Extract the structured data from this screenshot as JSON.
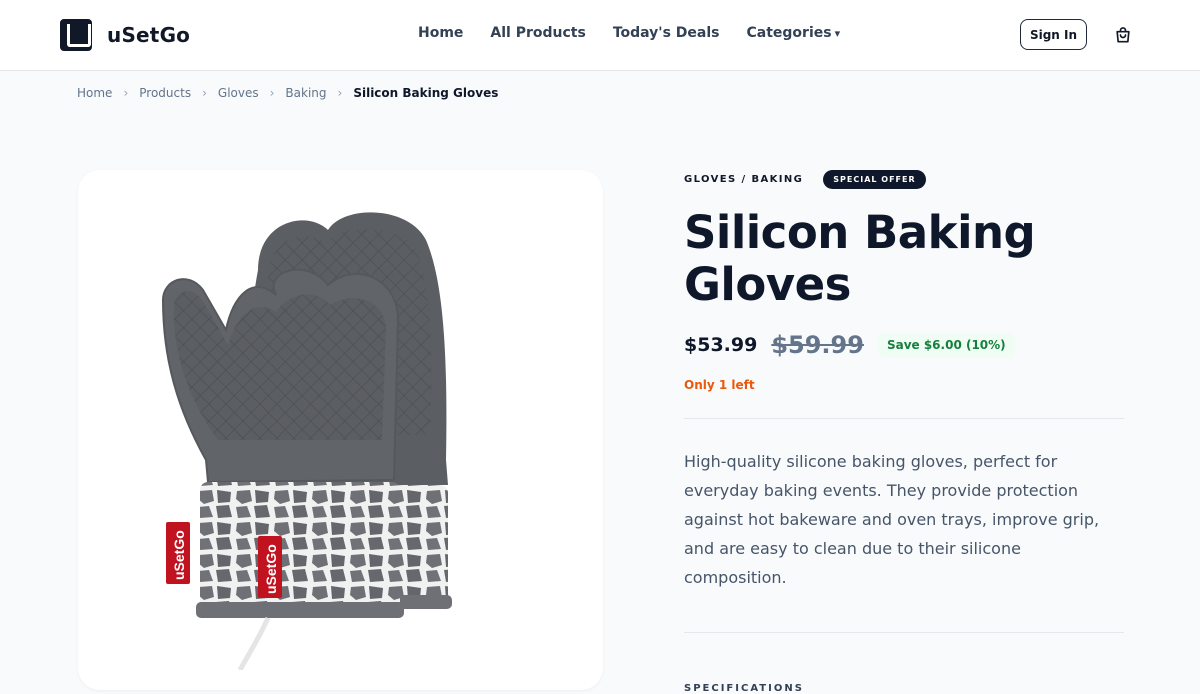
{
  "brand": {
    "name": "uSetGo"
  },
  "nav": {
    "items": [
      {
        "label": "Home"
      },
      {
        "label": "All Products"
      },
      {
        "label": "Today's Deals"
      },
      {
        "label": "Categories",
        "caret": "▾"
      }
    ]
  },
  "header": {
    "signin_label": "Sign In",
    "cart_icon": "cart-icon"
  },
  "breadcrumb": {
    "items": [
      "Home",
      "Products",
      "Gloves",
      "Baking"
    ],
    "separator": "›",
    "current": "Silicon Baking Gloves"
  },
  "product": {
    "category": "GLOVES / BAKING",
    "badge": "SPECIAL OFFER",
    "title": "Silicon Baking Gloves",
    "price": "$53.99",
    "old_price": "$59.99",
    "savings": "Save $6.00 (10%)",
    "stock": "Only 1 left",
    "description": "High-quality silicone baking gloves, perfect for everyday baking events. They provide protection against hot bakeware and oven trays, improve grip, and are easy to clean due to their silicone composition.",
    "image_label": "uSetGo",
    "specs_heading": "SPECIFICATIONS"
  },
  "colors": {
    "primary": "#0f172a",
    "accent_savings": "#15803d",
    "stock_warning": "#ea580c",
    "glove_gray": "#5b5e63"
  }
}
